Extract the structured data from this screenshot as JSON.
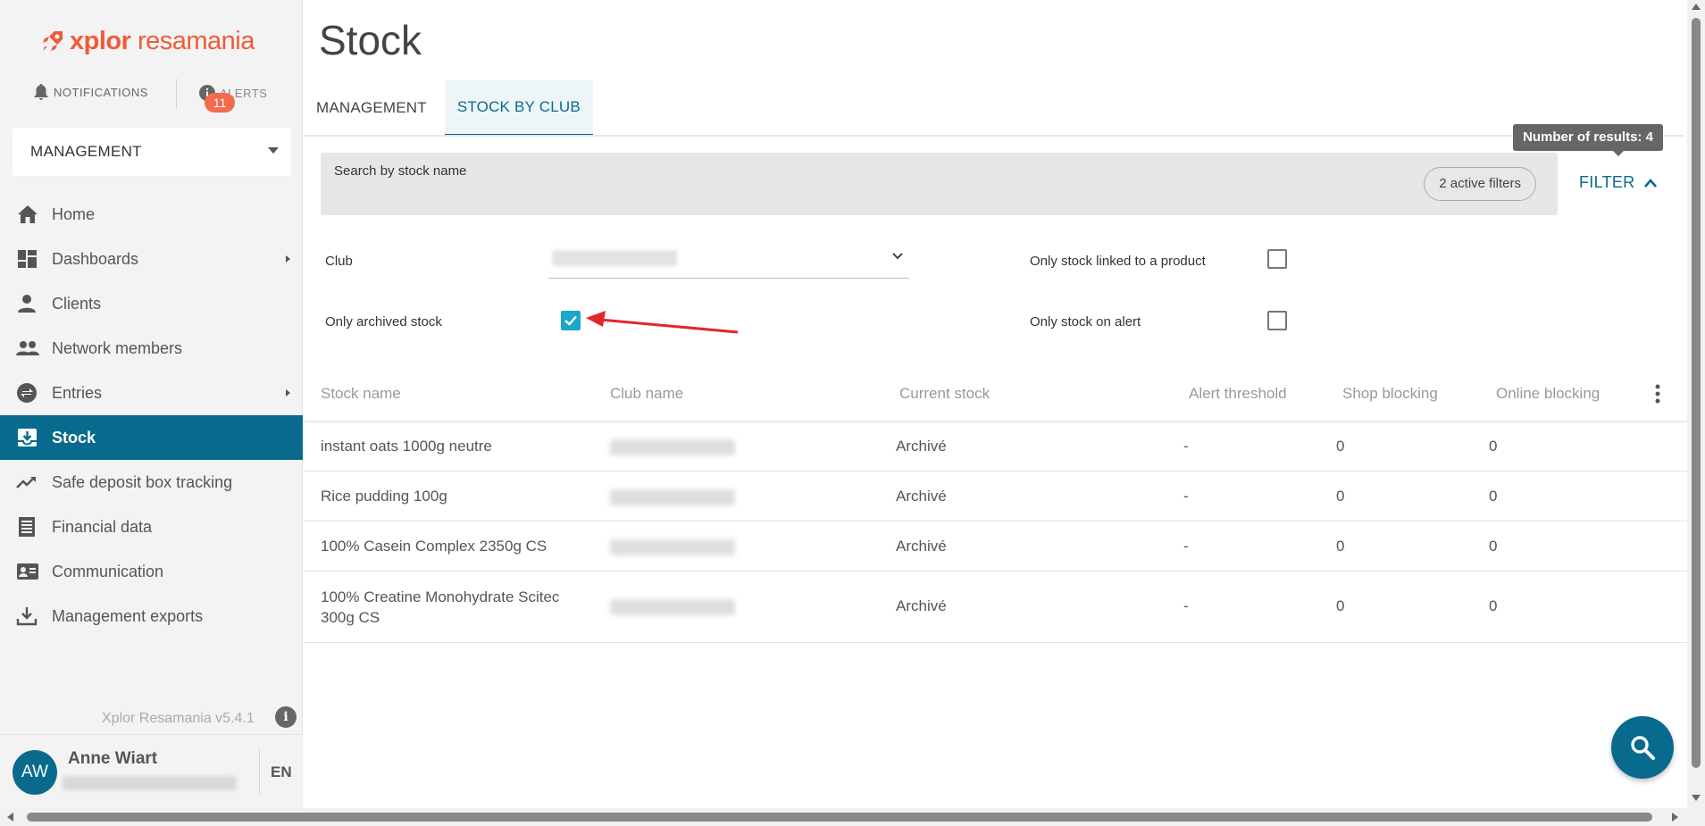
{
  "sidebar": {
    "logo": {
      "brand_x": "xplor",
      "brand_r": "resamania"
    },
    "notifications_label": "NOTIFICATIONS",
    "alerts_label": "ALERTS",
    "alerts_count": "11",
    "section": "MANAGEMENT",
    "items": [
      {
        "label": "Home",
        "icon": "home-icon",
        "has_arrow": false
      },
      {
        "label": "Dashboards",
        "icon": "dashboard-icon",
        "has_arrow": true
      },
      {
        "label": "Clients",
        "icon": "person-icon",
        "has_arrow": false
      },
      {
        "label": "Network members",
        "icon": "people-icon",
        "has_arrow": false
      },
      {
        "label": "Entries",
        "icon": "swap-icon",
        "has_arrow": true
      },
      {
        "label": "Stock",
        "icon": "inbox-icon",
        "has_arrow": false
      },
      {
        "label": "Safe deposit box tracking",
        "icon": "trending-icon",
        "has_arrow": false
      },
      {
        "label": "Financial data",
        "icon": "receipt-icon",
        "has_arrow": false
      },
      {
        "label": "Communication",
        "icon": "contact-card-icon",
        "has_arrow": false
      },
      {
        "label": "Management exports",
        "icon": "download-icon",
        "has_arrow": false
      }
    ],
    "active_item": "Stock",
    "version": "Xplor Resamania v5.4.1",
    "user": {
      "initials": "AW",
      "name": "Anne Wiart"
    },
    "language": "EN"
  },
  "main": {
    "title": "Stock",
    "tabs": [
      {
        "label": "MANAGEMENT",
        "active": false
      },
      {
        "label": "STOCK BY CLUB",
        "active": true
      }
    ],
    "search": {
      "label": "Search by stock name",
      "active_filters": "2 active filters"
    },
    "filter_button": "FILTER",
    "results_tooltip": "Number of results: 4",
    "filters": {
      "club_label": "Club",
      "only_archived_label": "Only archived stock",
      "only_archived_checked": true,
      "only_linked_label": "Only stock linked to a product",
      "only_linked_checked": false,
      "only_alert_label": "Only stock on alert",
      "only_alert_checked": false
    },
    "table": {
      "columns": [
        "Stock name",
        "Club name",
        "Current stock",
        "Alert threshold",
        "Shop blocking",
        "Online blocking"
      ],
      "rows": [
        {
          "stock_name": "instant oats 1000g neutre",
          "current_stock": "Archivé",
          "alert_threshold": "-",
          "shop_blocking": "0",
          "online_blocking": "0"
        },
        {
          "stock_name": "Rice pudding 100g",
          "current_stock": "Archivé",
          "alert_threshold": "-",
          "shop_blocking": "0",
          "online_blocking": "0"
        },
        {
          "stock_name": "100% Casein Complex 2350g CS",
          "current_stock": "Archivé",
          "alert_threshold": "-",
          "shop_blocking": "0",
          "online_blocking": "0"
        },
        {
          "stock_name": "100% Creatine Monohydrate Scitec 300g CS",
          "current_stock": "Archivé",
          "alert_threshold": "-",
          "shop_blocking": "0",
          "online_blocking": "0"
        }
      ]
    }
  },
  "colors": {
    "primary": "#086a8c",
    "accent_orange": "#ef5b3a",
    "checkbox_checked": "#1aa7c8",
    "annotation_arrow": "#e3262b"
  }
}
